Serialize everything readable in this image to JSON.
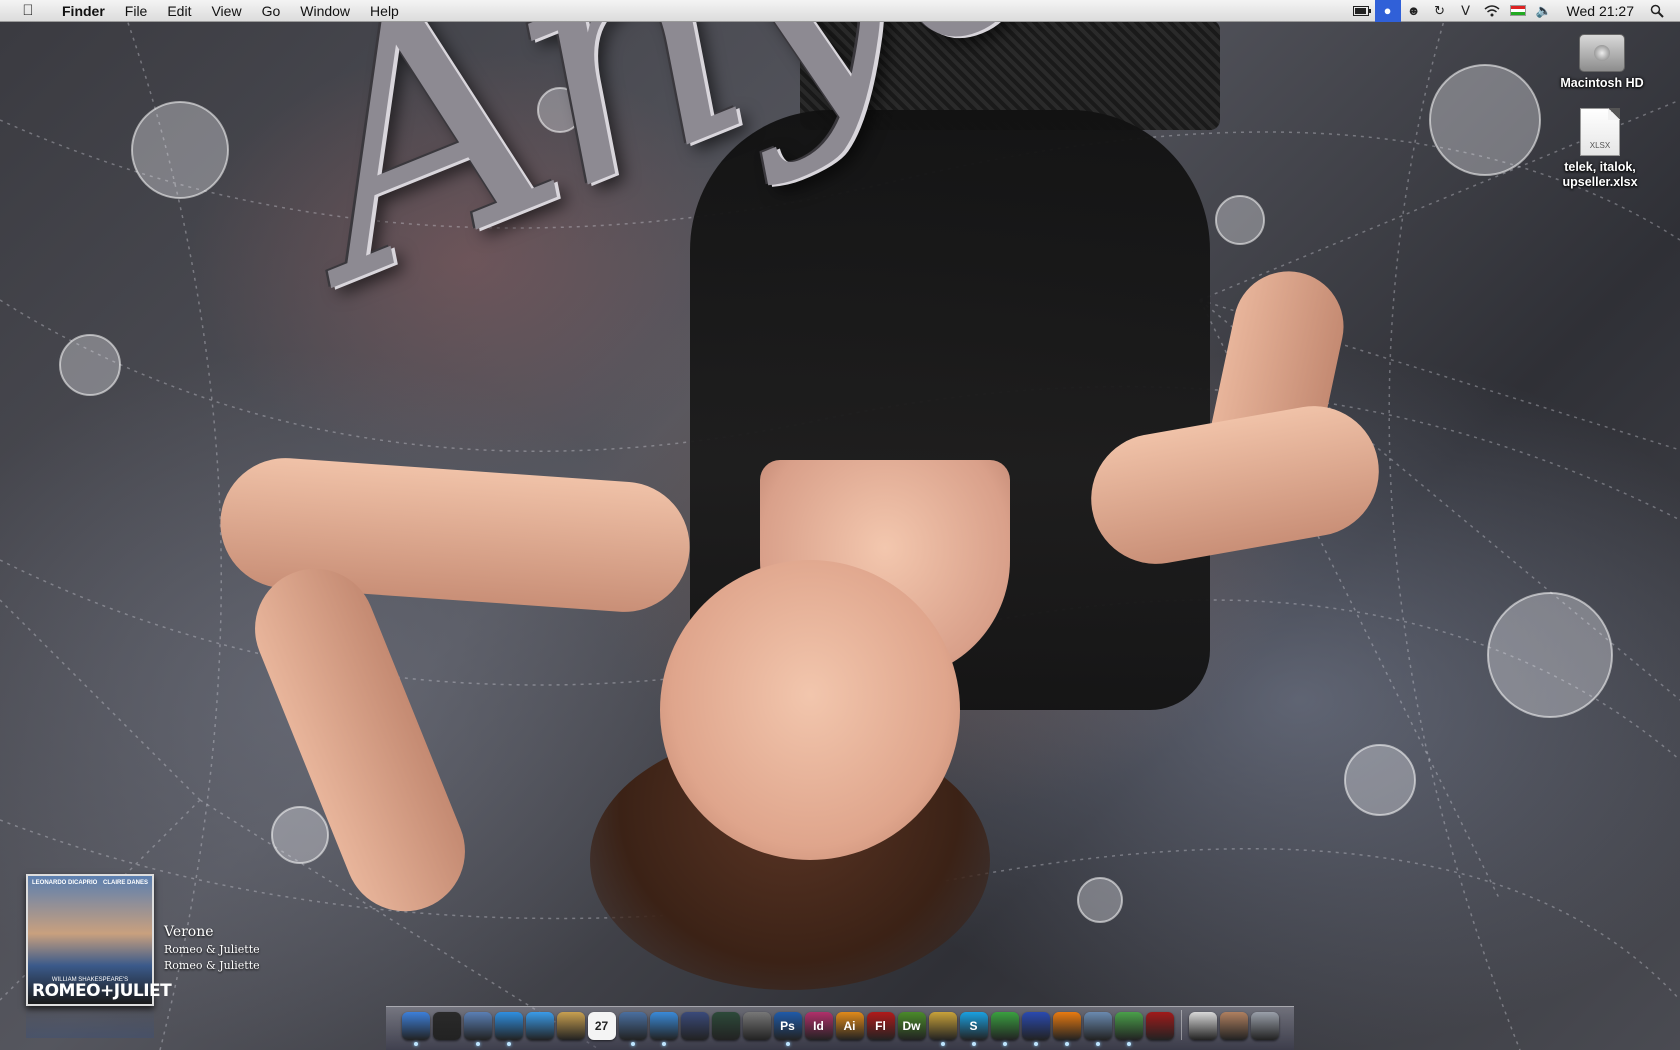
{
  "menubar": {
    "apple_icon": "apple-icon",
    "app_name": "Finder",
    "menus": [
      "File",
      "Edit",
      "View",
      "Go",
      "Window",
      "Help"
    ],
    "status_icons": [
      "battery-icon",
      "spotlight-app-icon",
      "alien-icon",
      "time-machine-icon",
      "bluetooth-icon",
      "wifi-icon",
      "hungarian-flag-icon",
      "volume-icon"
    ],
    "clock": "Wed 21:27",
    "search_icon": "spotlight-search-icon"
  },
  "wallpaper": {
    "title": "Anya",
    "accent": "#8d8a92"
  },
  "desktop_icons": [
    {
      "name": "Macintosh HD",
      "icon": "hard-drive-icon"
    },
    {
      "name": "telek, italok, upseller.xlsx",
      "icon": "xlsx-document-icon",
      "badge": "XLSX"
    }
  ],
  "itunes_widget": {
    "poster_top_left": "LEONARDO DICAPRIO",
    "poster_top_right": "CLAIRE DANES",
    "poster_subtitle": "WILLIAM SHAKESPEARE'S",
    "poster_title": "ROMEO+JULIET",
    "track": "Verone",
    "artist": "Romeo & Juliette",
    "album": "Romeo & Juliette"
  },
  "dock": {
    "items": [
      {
        "name": "finder",
        "label": "",
        "color": "#3d7fd9",
        "running": true
      },
      {
        "name": "dashboard",
        "label": "",
        "color": "#2a2a2a",
        "running": false
      },
      {
        "name": "mail",
        "label": "",
        "color": "#5a7fb5",
        "running": true
      },
      {
        "name": "safari",
        "label": "",
        "color": "#2f8fe0",
        "running": true
      },
      {
        "name": "ichat",
        "label": "",
        "color": "#3a9be8",
        "running": false
      },
      {
        "name": "address-book",
        "label": "",
        "color": "#c8a050",
        "running": false
      },
      {
        "name": "ical",
        "label": "27",
        "color": "#e8e8e8",
        "running": false
      },
      {
        "name": "iphoto",
        "label": "",
        "color": "#4a6fa0",
        "running": true
      },
      {
        "name": "itunes",
        "label": "",
        "color": "#3a8ad8",
        "running": true
      },
      {
        "name": "spaces",
        "label": "",
        "color": "#3a4a7a",
        "running": false
      },
      {
        "name": "time-machine",
        "label": "",
        "color": "#2d4a3a",
        "running": false
      },
      {
        "name": "system-preferences",
        "label": "",
        "color": "#777777",
        "running": false
      },
      {
        "name": "photoshop",
        "label": "Ps",
        "color": "#1f5aa8",
        "running": true
      },
      {
        "name": "indesign",
        "label": "Id",
        "color": "#b0306a",
        "running": false
      },
      {
        "name": "illustrator",
        "label": "Ai",
        "color": "#e08a1a",
        "running": false
      },
      {
        "name": "flash",
        "label": "Fl",
        "color": "#b01a1a",
        "running": false
      },
      {
        "name": "dreamweaver",
        "label": "Dw",
        "color": "#4a8a2a",
        "running": false
      },
      {
        "name": "cyberduck",
        "label": "",
        "color": "#c8a23a",
        "running": true
      },
      {
        "name": "skype",
        "label": "S",
        "color": "#1aa0e0",
        "running": true
      },
      {
        "name": "adium",
        "label": "",
        "color": "#3aa040",
        "running": true
      },
      {
        "name": "wizard",
        "label": "",
        "color": "#2a4ab0",
        "running": true
      },
      {
        "name": "vlc",
        "label": "",
        "color": "#e87a10",
        "running": true
      },
      {
        "name": "preview",
        "label": "",
        "color": "#6a8ab0",
        "running": true
      },
      {
        "name": "alien-app",
        "label": "",
        "color": "#4aa04a",
        "running": true
      },
      {
        "name": "acrobat",
        "label": "",
        "color": "#a01a1a",
        "running": false
      },
      {
        "name": "documents-stack",
        "label": "",
        "color": "#d8d8d8",
        "running": false
      },
      {
        "name": "downloads-stack",
        "label": "",
        "color": "#b08060",
        "running": false
      },
      {
        "name": "trash",
        "label": "",
        "color": "#9aa0aa",
        "running": false
      }
    ]
  }
}
